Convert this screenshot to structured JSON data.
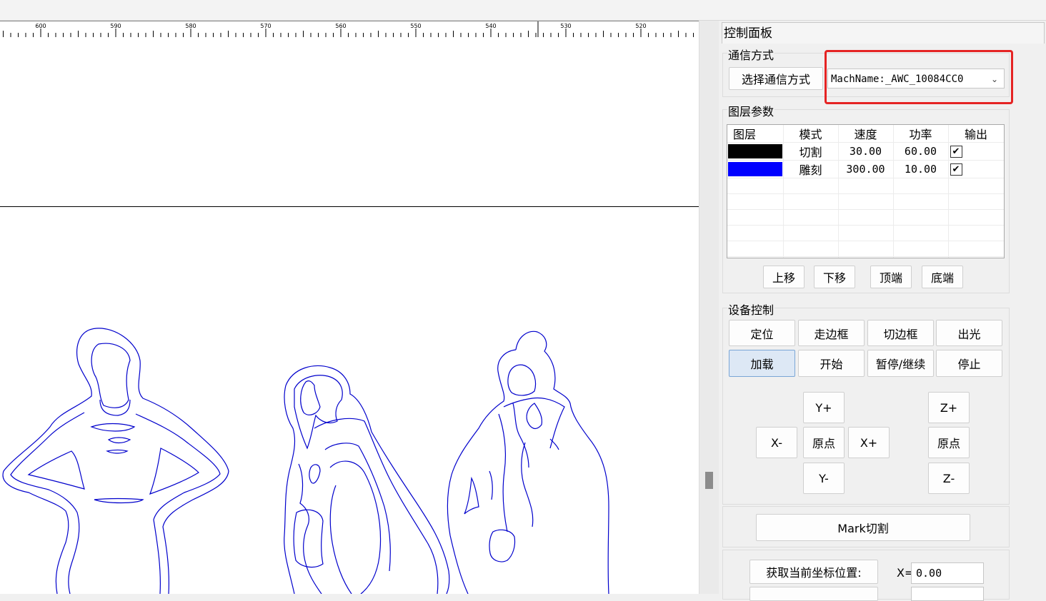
{
  "ruler": {
    "labels": [
      "600",
      "590",
      "580",
      "570",
      "560",
      "550",
      "540",
      "530",
      "520"
    ]
  },
  "panel": {
    "title": "控制面板",
    "comm": {
      "group_label": "通信方式",
      "select_button": "选择通信方式",
      "machine_value": "MachName:_AWC_10084CC0"
    },
    "layers": {
      "group_label": "图层参数",
      "headers": [
        "图层",
        "模式",
        "速度",
        "功率",
        "输出"
      ],
      "rows": [
        {
          "color": "#000000",
          "mode": "切割",
          "speed": "30.00",
          "power": "60.00",
          "output": true
        },
        {
          "color": "#0000ff",
          "mode": "雕刻",
          "speed": "300.00",
          "power": "10.00",
          "output": true
        }
      ],
      "buttons": {
        "up": "上移",
        "down": "下移",
        "top": "顶端",
        "bottom": "底端"
      }
    },
    "device": {
      "group_label": "设备控制",
      "buttons": {
        "locate": "定位",
        "frame": "走边框",
        "cut_frame": "切边框",
        "fire": "出光",
        "load": "加载",
        "start": "开始",
        "pause": "暂停/继续",
        "stop": "停止"
      },
      "jog": {
        "y_plus": "Y+",
        "y_minus": "Y-",
        "x_minus": "X-",
        "x_plus": "X+",
        "origin_xy": "原点",
        "z_plus": "Z+",
        "z_minus": "Z-",
        "origin_z": "原点"
      }
    },
    "mark_cut": "Mark切割",
    "position": {
      "get_button": "获取当前坐标位置:",
      "x_label": "X=",
      "x_value": "0.00"
    }
  },
  "colors": {
    "highlight": "#e52424",
    "drawing_stroke": "#0000cc",
    "active_button": "#dde8f5"
  }
}
